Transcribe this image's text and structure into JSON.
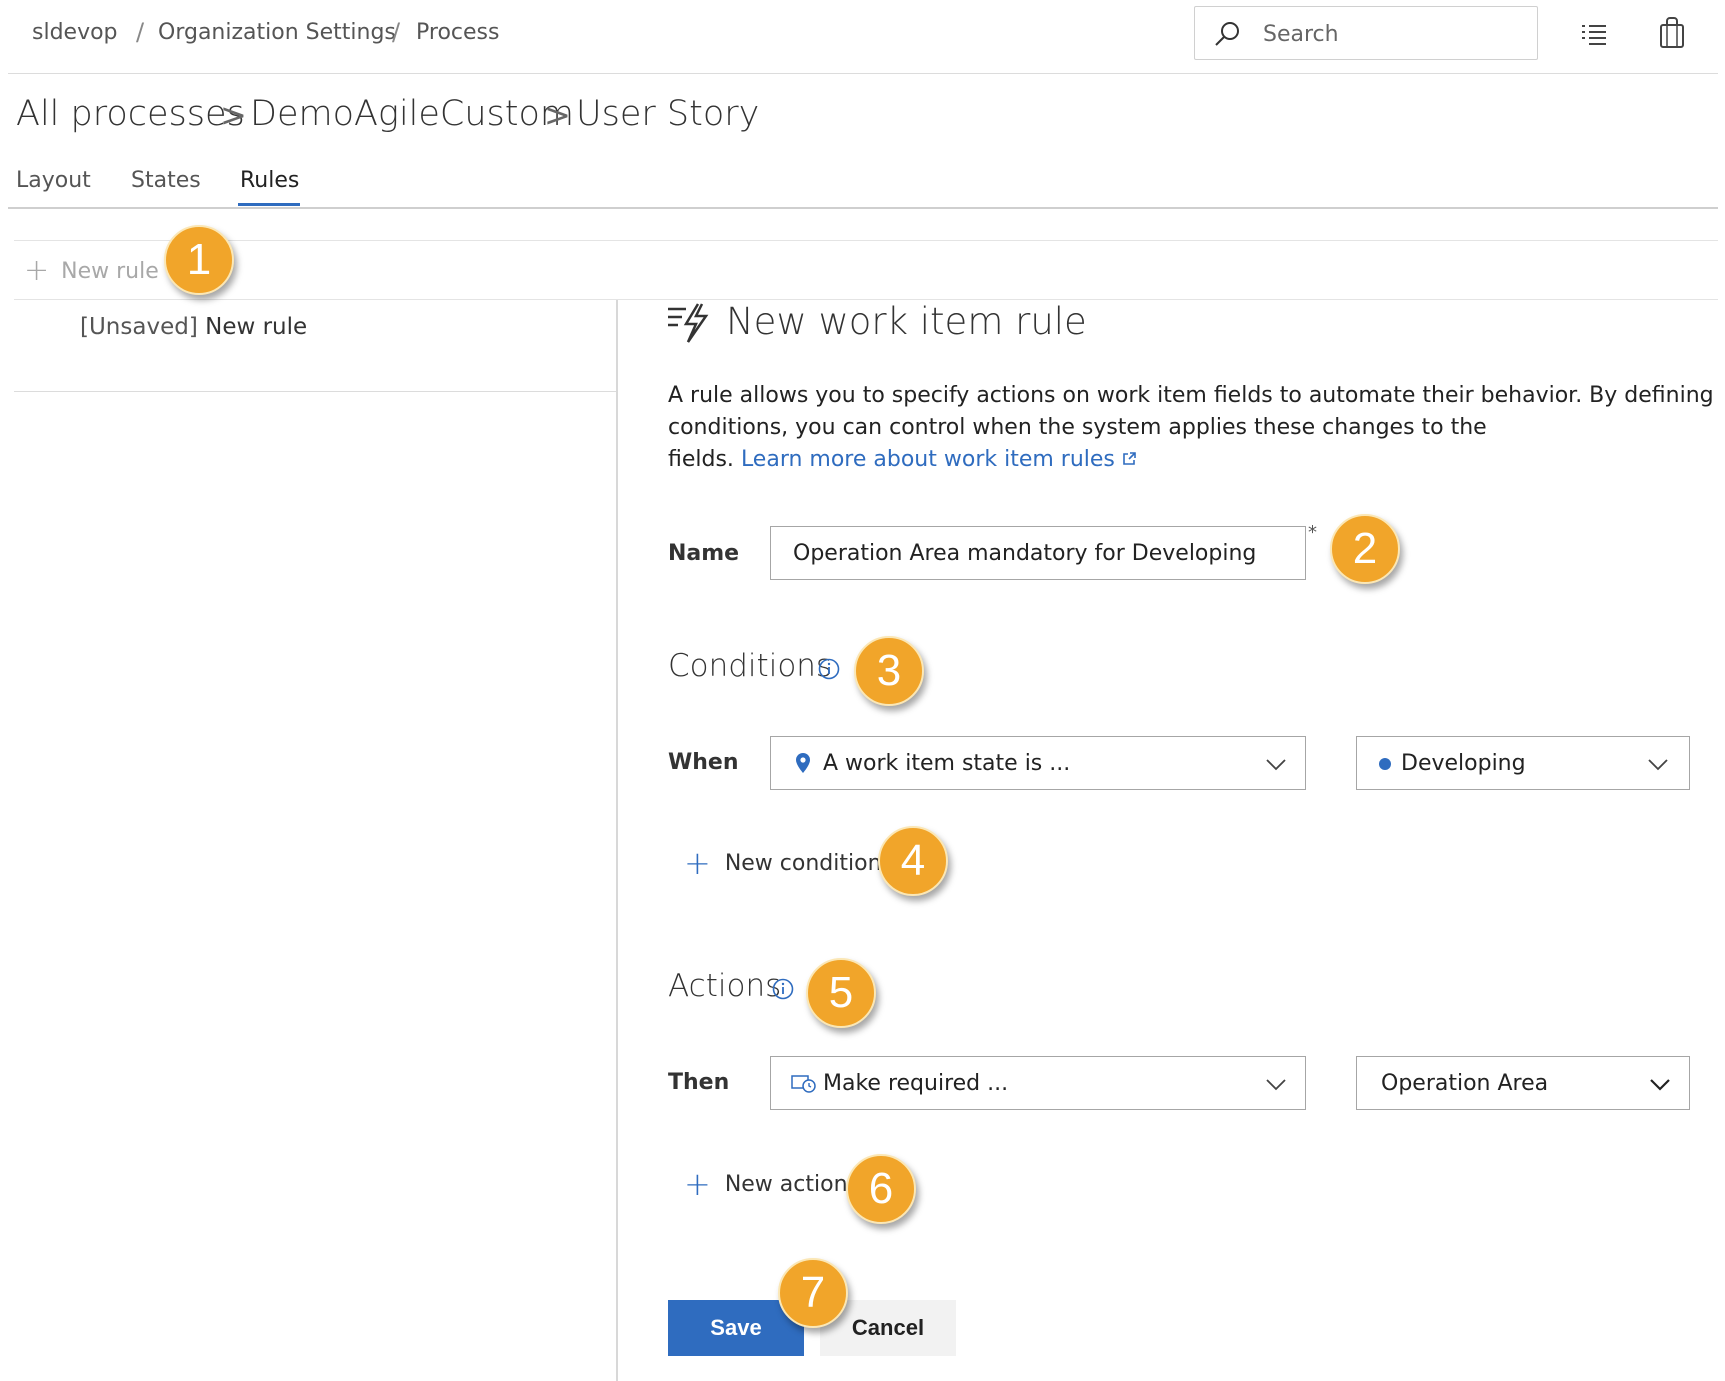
{
  "topbar": {
    "breadcrumbs": [
      "sldevop",
      "Organization Settings",
      "Process"
    ],
    "separator": "/",
    "search_placeholder": "Search"
  },
  "header": {
    "breadcrumbs": [
      "All processes",
      "DemoAgileCustom",
      "User Story"
    ],
    "chevron": ">"
  },
  "tabs": [
    {
      "label": "Layout",
      "active": false
    },
    {
      "label": "States",
      "active": false
    },
    {
      "label": "Rules",
      "active": true
    }
  ],
  "toolbar": {
    "new_rule_label": "New rule"
  },
  "rules_list": [
    {
      "prefix": "[Unsaved]",
      "name": "New rule"
    }
  ],
  "editor": {
    "title": "New work item rule",
    "description_lines": [
      "A rule allows you to specify actions on work item fields to automate their behavior. By defining",
      "conditions, you can control when the system applies these changes to the",
      "fields."
    ],
    "learn_more": "Learn more about work item rules",
    "name_label": "Name",
    "name_value": "Operation Area mandatory for Developing",
    "required_mark": "*",
    "conditions_heading": "Conditions",
    "when_label": "When",
    "condition_field": "A work item state is ...",
    "condition_value": "Developing",
    "new_condition_label": "New condition",
    "actions_heading": "Actions",
    "then_label": "Then",
    "action_field": "Make required ...",
    "action_value": "Operation Area",
    "new_action_label": "New action",
    "save_label": "Save",
    "cancel_label": "Cancel"
  },
  "callouts": [
    "1",
    "2",
    "3",
    "4",
    "5",
    "6",
    "7"
  ],
  "colors": {
    "accent": "#2f6cbf",
    "callout": "#f1a52a",
    "state_dot": "#2f6cbf"
  }
}
